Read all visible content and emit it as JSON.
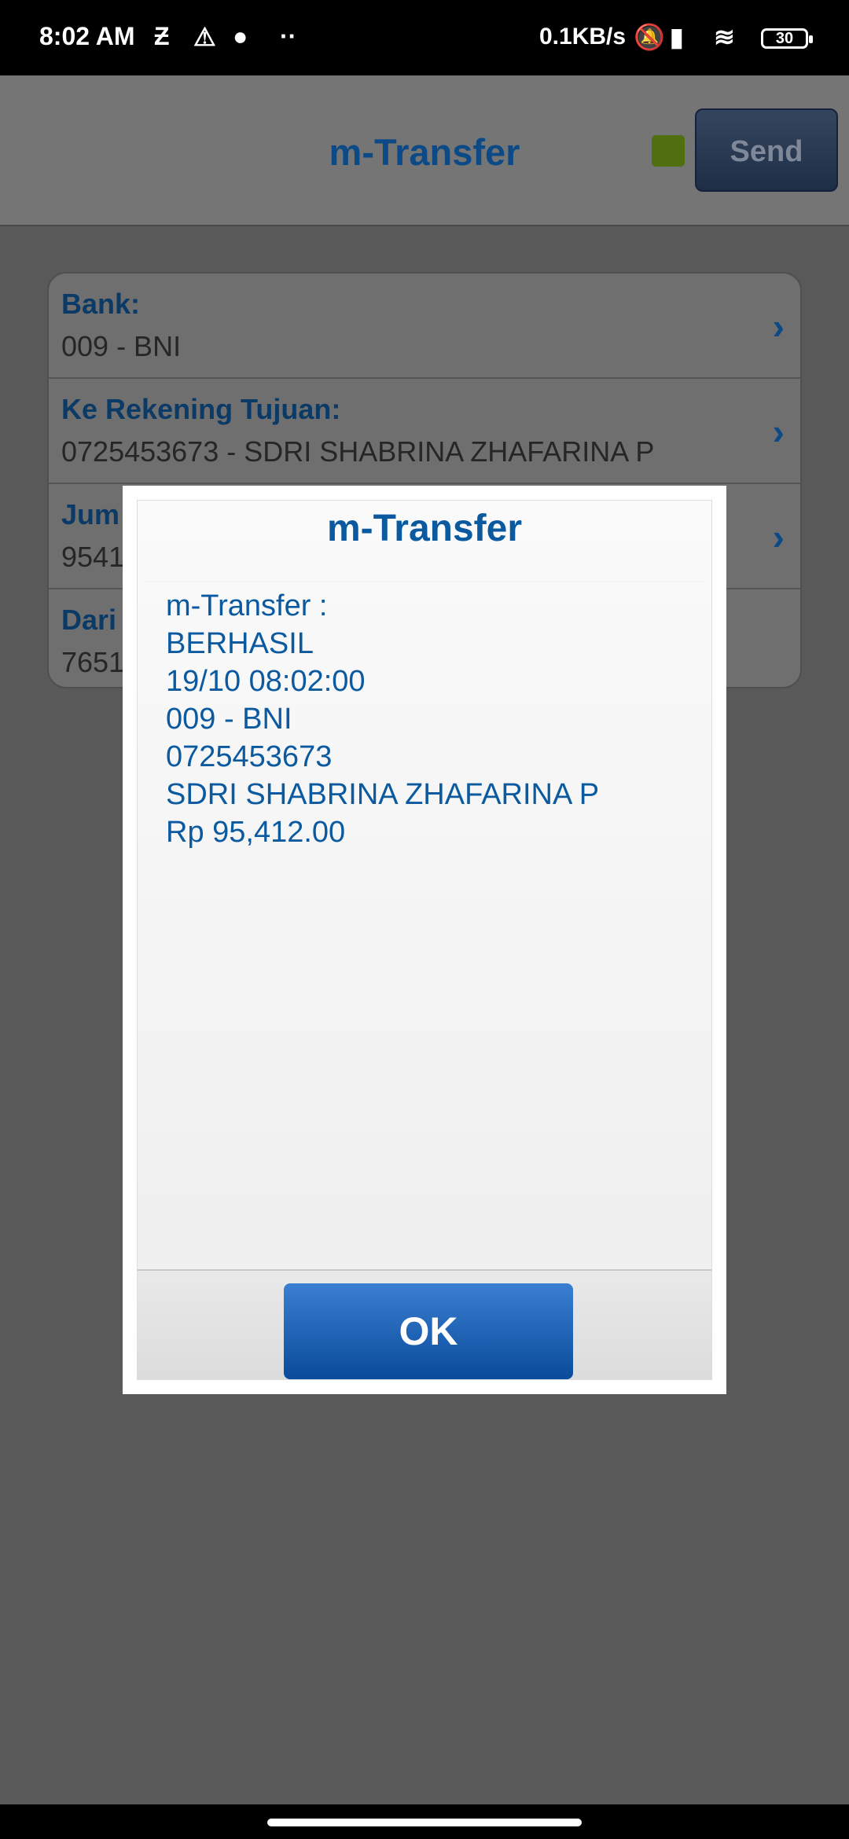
{
  "status_bar": {
    "time": "8:02 AM",
    "icons_left": [
      "z-icon",
      "alert-icon",
      "line-icon",
      "dots-icon"
    ],
    "network_speed": "0.1KB/s",
    "icons_right": [
      "muted-bell-icon",
      "signal-icon",
      "wifi-icon"
    ],
    "battery": "30"
  },
  "header": {
    "title": "m-Transfer",
    "status_color": "#4f6f10",
    "send_label": "Send"
  },
  "form": {
    "rows": [
      {
        "label": "Bank:",
        "value": "009 - BNI"
      },
      {
        "label": "Ke Rekening Tujuan:",
        "value": "0725453673 - SDRI SHABRINA  ZHAFARINA P"
      },
      {
        "label": "Jum",
        "value": "9541"
      },
      {
        "label": "Dari",
        "value": "7651"
      }
    ]
  },
  "dialog": {
    "title": "m-Transfer",
    "lines": [
      "m-Transfer :",
      "BERHASIL",
      "19/10 08:02:00",
      "009 - BNI",
      "0725453673",
      "SDRI SHABRINA  ZHAFARINA P",
      "Rp 95,412.00"
    ],
    "ok_label": "OK"
  },
  "colors": {
    "accent": "#0b5aa0",
    "overlay": "#595959",
    "ok_button": "#0a4b9b"
  }
}
